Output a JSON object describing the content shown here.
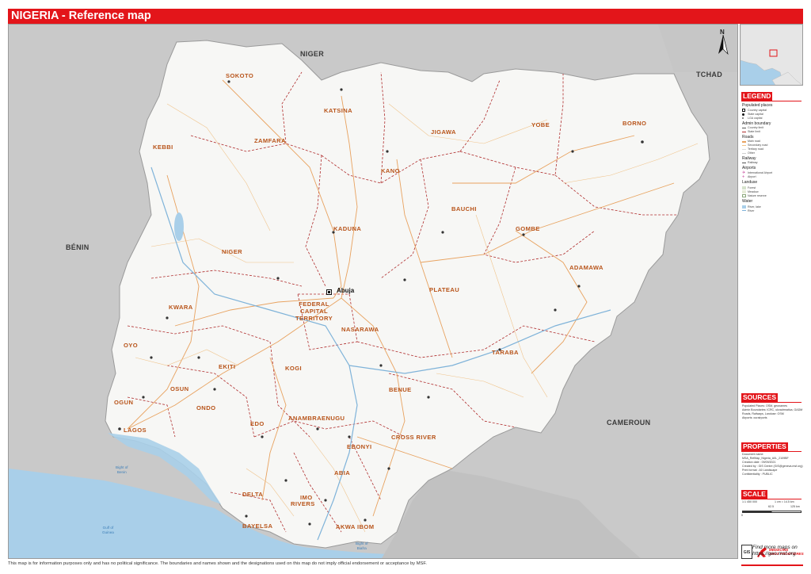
{
  "title": "NIGERIA - Reference map",
  "colors": {
    "accent": "#e3151a",
    "land_nigeria": "#f7f7f5",
    "land_neighbours": "#c9c9c9",
    "water": "#a9cfe9",
    "state_label": "#b8541a",
    "road_main": "#e8a25f",
    "road_secondary": "#f0c48c",
    "boundary": "#b02d2d"
  },
  "countries": {
    "niger": "NIGER",
    "tchad": "TCHAD",
    "benin": "BÉNIN",
    "cameroun": "CAMEROUN",
    "cameroun_north": "CAMEROUN"
  },
  "states": [
    {
      "key": "sokoto",
      "name": "SOKOTO"
    },
    {
      "key": "katsina",
      "name": "KATSINA"
    },
    {
      "key": "jigawa",
      "name": "JIGAWA"
    },
    {
      "key": "yobe",
      "name": "YOBE"
    },
    {
      "key": "borno",
      "name": "BORNO"
    },
    {
      "key": "kebbi",
      "name": "KEBBI"
    },
    {
      "key": "zamfara",
      "name": "ZAMFARA"
    },
    {
      "key": "kano",
      "name": "KANO"
    },
    {
      "key": "bauchi",
      "name": "BAUCHI"
    },
    {
      "key": "gombe",
      "name": "GOMBE"
    },
    {
      "key": "kaduna",
      "name": "KADUNA"
    },
    {
      "key": "niger",
      "name": "NIGER"
    },
    {
      "key": "adamawa",
      "name": "ADAMAWA"
    },
    {
      "key": "plateau",
      "name": "PLATEAU"
    },
    {
      "key": "fct",
      "name": "FEDERAL\nCAPITAL\nTERRITORY"
    },
    {
      "key": "kwara",
      "name": "KWARA"
    },
    {
      "key": "nasarawa",
      "name": "NASARAWA"
    },
    {
      "key": "oyo",
      "name": "OYO"
    },
    {
      "key": "taraba",
      "name": "TARABA"
    },
    {
      "key": "ekiti",
      "name": "EKITI"
    },
    {
      "key": "kogi",
      "name": "KOGI"
    },
    {
      "key": "osun",
      "name": "OSUN"
    },
    {
      "key": "ondo",
      "name": "ONDO"
    },
    {
      "key": "benue",
      "name": "BENUE"
    },
    {
      "key": "ogun",
      "name": "OGUN"
    },
    {
      "key": "edo",
      "name": "EDO"
    },
    {
      "key": "anambra",
      "name": "ANAMBRA"
    },
    {
      "key": "enugu",
      "name": "ENUGU"
    },
    {
      "key": "lagos",
      "name": "LAGOS"
    },
    {
      "key": "cross_river",
      "name": "CROSS RIVER"
    },
    {
      "key": "ebonyi",
      "name": "EBONYI"
    },
    {
      "key": "abia",
      "name": "ABIA"
    },
    {
      "key": "delta",
      "name": "DELTA"
    },
    {
      "key": "imo",
      "name": "IMO"
    },
    {
      "key": "rivers",
      "name": "RIVERS"
    },
    {
      "key": "bayelsa",
      "name": "BAYELSA"
    },
    {
      "key": "akwa_ibom",
      "name": "AKWA IBOM"
    }
  ],
  "capital": "Abuja",
  "water_labels": {
    "bight_of_benin": "Bight of\nBenin",
    "gulf_of_guinea": "Gulf of\nGuinea",
    "bight_of_biafra": "Bight of\nBiafra"
  },
  "north_arrow": "N",
  "legend": {
    "heading": "LEGEND",
    "groups": [
      {
        "title": "Populated places",
        "items": [
          "Country capital",
          "State capital",
          "LGA capital"
        ]
      },
      {
        "title": "Admin boundary",
        "items": [
          "Country limit",
          "State limit"
        ]
      },
      {
        "title": "Roads",
        "items": [
          "Main road",
          "Secondary road",
          "Tertiary road",
          "Other"
        ]
      },
      {
        "title": "Railway",
        "items": [
          "Railway"
        ]
      },
      {
        "title": "Airports",
        "items": [
          "International Airport",
          "Airport"
        ]
      },
      {
        "title": "Landuse",
        "items": [
          "Forest",
          "Meadow",
          "Nature reserve"
        ]
      },
      {
        "title": "Water",
        "items": [
          "River, lake",
          "River"
        ]
      }
    ]
  },
  "sources": {
    "heading": "SOURCES",
    "lines": [
      "Populated Places: OSM, geonames",
      "Admin Boundaries: ICRC, ukvadrmatica, GADM",
      "Roads, Railways, Landuse: OSM",
      "Airports: ourairports"
    ]
  },
  "properties": {
    "heading": "PROPERTIES",
    "lines": [
      "Document name:",
      "MSA_RefMap_Nigeria_A0L_2109BF",
      "Creation date : 09/09/2021",
      "Created by : GIS Centre (GIS@geneva.msf.org)",
      "Print format : A0 Landscape",
      "Confidentiality : PUBLIC"
    ]
  },
  "scale": {
    "heading": "SCALE",
    "ratio": "1:1 450 000",
    "equivalence": "1 cm = 14.5 km",
    "mid": "62.5",
    "end": "125 km",
    "start": "0"
  },
  "logos": {
    "gis": "GIS",
    "msf": "MEDECINS\nSANS FRONTIERES"
  },
  "find_more": "Find more maps on\nhttps://geo.msf.org",
  "disclaimer": "This map is for information purposes only and has no political significance. The boundaries and names shown and the designations used on this map do not imply official endorsement or acceptance by MSF."
}
